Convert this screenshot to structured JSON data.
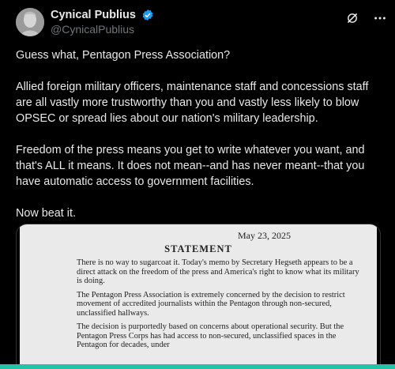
{
  "account": {
    "display_name": "Cynical Publius",
    "handle": "@CynicalPublius",
    "verified": true,
    "verified_color": "#1d9bf0"
  },
  "tweet": {
    "paragraphs": [
      "Guess what, Pentagon Press Association?",
      "Allied foreign military officers, maintenance staff and concessions staff are all vastly more trustworthy than you and vastly less likely to blow OPSEC or spread lies about our nation's military leadership.",
      "Freedom of the press means you get to write whatever you want, and that's ALL it means.  It does not mean--and has never meant--that you have automatic access to government facilities.",
      "Now beat it."
    ]
  },
  "icons": {
    "verified": "verified-badge-icon",
    "grok": "grok-icon",
    "more": "more-icon"
  },
  "media": {
    "document": {
      "date": "May 23, 2025",
      "heading": "STATEMENT",
      "paragraphs": [
        "There is no way to sugarcoat it. Today's memo by Secretary Hegseth appears to be a direct attack on the freedom of the press and America's right to know what its military is doing.",
        "The Pentagon Press Association is extremely concerned by the decision to restrict movement of accredited journalists within the Pentagon through non-secured, unclassified hallways.",
        "The decision is purportedly based on concerns about operational security.  But the Pentagon Press Corps has had access to non-secured, unclassified spaces in the Pentagon for decades, under"
      ]
    }
  },
  "colors": {
    "background": "#000000",
    "text": "#e7e9ea",
    "muted": "#71767b",
    "bottom_accent": "#22c3a6"
  }
}
